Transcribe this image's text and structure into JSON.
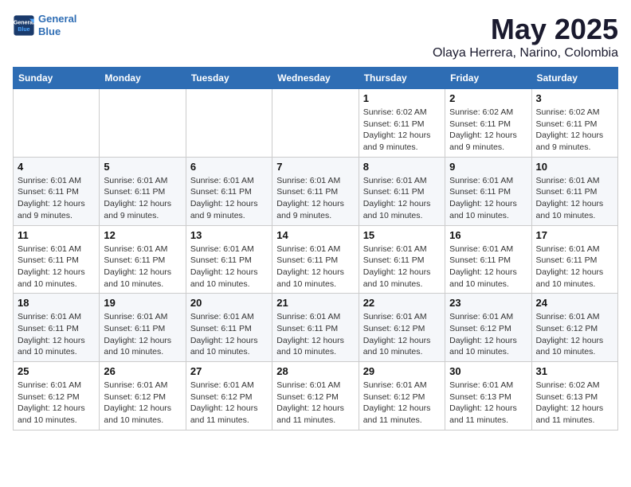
{
  "header": {
    "logo_line1": "General",
    "logo_line2": "Blue",
    "month": "May 2025",
    "location": "Olaya Herrera, Narino, Colombia"
  },
  "weekdays": [
    "Sunday",
    "Monday",
    "Tuesday",
    "Wednesday",
    "Thursday",
    "Friday",
    "Saturday"
  ],
  "weeks": [
    [
      {
        "day": "",
        "info": ""
      },
      {
        "day": "",
        "info": ""
      },
      {
        "day": "",
        "info": ""
      },
      {
        "day": "",
        "info": ""
      },
      {
        "day": "1",
        "info": "Sunrise: 6:02 AM\nSunset: 6:11 PM\nDaylight: 12 hours\nand 9 minutes."
      },
      {
        "day": "2",
        "info": "Sunrise: 6:02 AM\nSunset: 6:11 PM\nDaylight: 12 hours\nand 9 minutes."
      },
      {
        "day": "3",
        "info": "Sunrise: 6:02 AM\nSunset: 6:11 PM\nDaylight: 12 hours\nand 9 minutes."
      }
    ],
    [
      {
        "day": "4",
        "info": "Sunrise: 6:01 AM\nSunset: 6:11 PM\nDaylight: 12 hours\nand 9 minutes."
      },
      {
        "day": "5",
        "info": "Sunrise: 6:01 AM\nSunset: 6:11 PM\nDaylight: 12 hours\nand 9 minutes."
      },
      {
        "day": "6",
        "info": "Sunrise: 6:01 AM\nSunset: 6:11 PM\nDaylight: 12 hours\nand 9 minutes."
      },
      {
        "day": "7",
        "info": "Sunrise: 6:01 AM\nSunset: 6:11 PM\nDaylight: 12 hours\nand 9 minutes."
      },
      {
        "day": "8",
        "info": "Sunrise: 6:01 AM\nSunset: 6:11 PM\nDaylight: 12 hours\nand 10 minutes."
      },
      {
        "day": "9",
        "info": "Sunrise: 6:01 AM\nSunset: 6:11 PM\nDaylight: 12 hours\nand 10 minutes."
      },
      {
        "day": "10",
        "info": "Sunrise: 6:01 AM\nSunset: 6:11 PM\nDaylight: 12 hours\nand 10 minutes."
      }
    ],
    [
      {
        "day": "11",
        "info": "Sunrise: 6:01 AM\nSunset: 6:11 PM\nDaylight: 12 hours\nand 10 minutes."
      },
      {
        "day": "12",
        "info": "Sunrise: 6:01 AM\nSunset: 6:11 PM\nDaylight: 12 hours\nand 10 minutes."
      },
      {
        "day": "13",
        "info": "Sunrise: 6:01 AM\nSunset: 6:11 PM\nDaylight: 12 hours\nand 10 minutes."
      },
      {
        "day": "14",
        "info": "Sunrise: 6:01 AM\nSunset: 6:11 PM\nDaylight: 12 hours\nand 10 minutes."
      },
      {
        "day": "15",
        "info": "Sunrise: 6:01 AM\nSunset: 6:11 PM\nDaylight: 12 hours\nand 10 minutes."
      },
      {
        "day": "16",
        "info": "Sunrise: 6:01 AM\nSunset: 6:11 PM\nDaylight: 12 hours\nand 10 minutes."
      },
      {
        "day": "17",
        "info": "Sunrise: 6:01 AM\nSunset: 6:11 PM\nDaylight: 12 hours\nand 10 minutes."
      }
    ],
    [
      {
        "day": "18",
        "info": "Sunrise: 6:01 AM\nSunset: 6:11 PM\nDaylight: 12 hours\nand 10 minutes."
      },
      {
        "day": "19",
        "info": "Sunrise: 6:01 AM\nSunset: 6:11 PM\nDaylight: 12 hours\nand 10 minutes."
      },
      {
        "day": "20",
        "info": "Sunrise: 6:01 AM\nSunset: 6:11 PM\nDaylight: 12 hours\nand 10 minutes."
      },
      {
        "day": "21",
        "info": "Sunrise: 6:01 AM\nSunset: 6:11 PM\nDaylight: 12 hours\nand 10 minutes."
      },
      {
        "day": "22",
        "info": "Sunrise: 6:01 AM\nSunset: 6:12 PM\nDaylight: 12 hours\nand 10 minutes."
      },
      {
        "day": "23",
        "info": "Sunrise: 6:01 AM\nSunset: 6:12 PM\nDaylight: 12 hours\nand 10 minutes."
      },
      {
        "day": "24",
        "info": "Sunrise: 6:01 AM\nSunset: 6:12 PM\nDaylight: 12 hours\nand 10 minutes."
      }
    ],
    [
      {
        "day": "25",
        "info": "Sunrise: 6:01 AM\nSunset: 6:12 PM\nDaylight: 12 hours\nand 10 minutes."
      },
      {
        "day": "26",
        "info": "Sunrise: 6:01 AM\nSunset: 6:12 PM\nDaylight: 12 hours\nand 10 minutes."
      },
      {
        "day": "27",
        "info": "Sunrise: 6:01 AM\nSunset: 6:12 PM\nDaylight: 12 hours\nand 11 minutes."
      },
      {
        "day": "28",
        "info": "Sunrise: 6:01 AM\nSunset: 6:12 PM\nDaylight: 12 hours\nand 11 minutes."
      },
      {
        "day": "29",
        "info": "Sunrise: 6:01 AM\nSunset: 6:12 PM\nDaylight: 12 hours\nand 11 minutes."
      },
      {
        "day": "30",
        "info": "Sunrise: 6:01 AM\nSunset: 6:13 PM\nDaylight: 12 hours\nand 11 minutes."
      },
      {
        "day": "31",
        "info": "Sunrise: 6:02 AM\nSunset: 6:13 PM\nDaylight: 12 hours\nand 11 minutes."
      }
    ]
  ]
}
